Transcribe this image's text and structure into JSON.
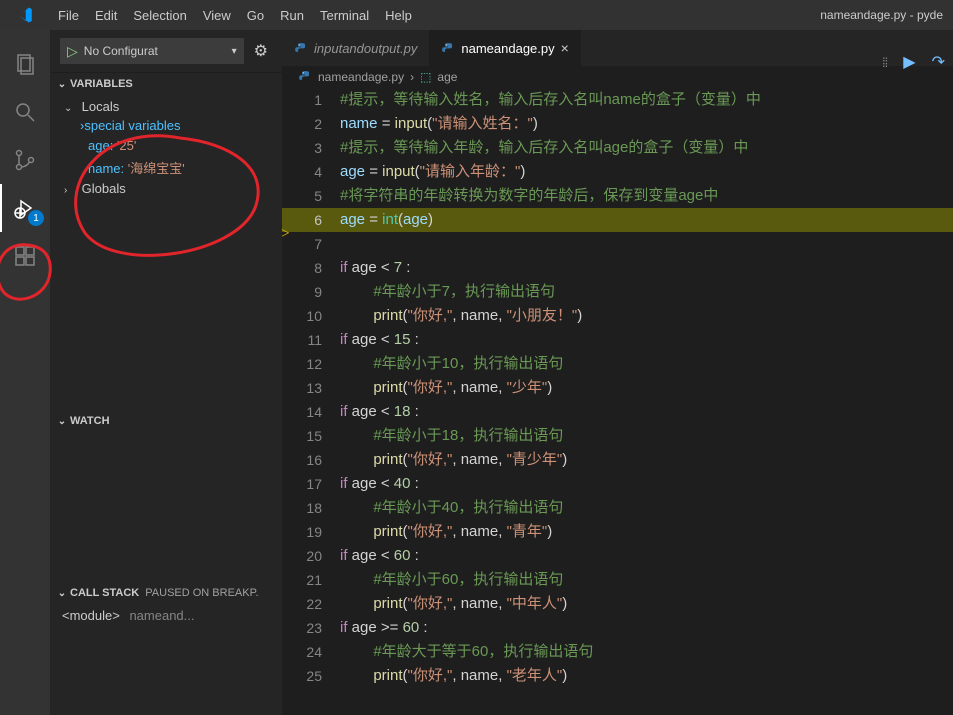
{
  "title": "nameandage.py - pyde",
  "menu": [
    "File",
    "Edit",
    "Selection",
    "View",
    "Go",
    "Run",
    "Terminal",
    "Help"
  ],
  "activitybar": {
    "debug_badge": "1"
  },
  "toolbar_icons": {
    "grip": "⁞⁞",
    "continue": "▶",
    "stepover": "↷"
  },
  "run_config": {
    "play": "▷",
    "label": "No Configurat",
    "gear": "⚙"
  },
  "panels": {
    "variables": "VARIABLES",
    "watch": "WATCH",
    "callstack": "CALL STACK",
    "callstack_status": "PAUSED ON BREAKP."
  },
  "scopes": {
    "locals": "Locals",
    "globals": "Globals",
    "special": "special variables"
  },
  "vars": [
    {
      "name": "age",
      "value": "'25'"
    },
    {
      "name": "name",
      "value": "'海绵宝宝'"
    }
  ],
  "callstack": [
    {
      "name": "<module>",
      "loc": "nameand..."
    }
  ],
  "tabs": [
    {
      "label": "inputandoutput.py",
      "active": false
    },
    {
      "label": "nameandage.py",
      "active": true
    }
  ],
  "breadcrumb": {
    "file": "nameandage.py",
    "symbol": "age"
  },
  "code": [
    {
      "n": 1,
      "tokens": [
        [
          "#提示，等待输入姓名，输入后存入名叫name的盒子（变量）中",
          "c-comm"
        ]
      ]
    },
    {
      "n": 2,
      "tokens": [
        [
          "name",
          "c-ident"
        ],
        [
          " = ",
          "c-op"
        ],
        [
          "input",
          "c-func"
        ],
        [
          "(",
          "c-op"
        ],
        [
          "\"请输入姓名：\"",
          "c-str"
        ],
        [
          ")",
          "c-op"
        ]
      ]
    },
    {
      "n": 3,
      "tokens": [
        [
          "#提示，等待输入年龄，输入后存入名叫age的盒子（变量）中",
          "c-comm"
        ]
      ]
    },
    {
      "n": 4,
      "tokens": [
        [
          "age",
          "c-ident"
        ],
        [
          " = ",
          "c-op"
        ],
        [
          "input",
          "c-func"
        ],
        [
          "(",
          "c-op"
        ],
        [
          "\"请输入年龄：\"",
          "c-str"
        ],
        [
          ")",
          "c-op"
        ]
      ]
    },
    {
      "n": 5,
      "tokens": [
        [
          "#将字符串的年龄转换为数字的年龄后，保存到变量age中",
          "c-comm"
        ]
      ]
    },
    {
      "n": 6,
      "hl": true,
      "arrow": true,
      "tokens": [
        [
          "age",
          "c-ident"
        ],
        [
          " = ",
          "c-op"
        ],
        [
          "int",
          "c-builtin"
        ],
        [
          "(",
          "c-op"
        ],
        [
          "age",
          "c-ident"
        ],
        [
          ")",
          "c-op"
        ]
      ]
    },
    {
      "n": 7,
      "tokens": []
    },
    {
      "n": 8,
      "tokens": [
        [
          "if",
          "c-kw"
        ],
        [
          " age < ",
          "c-op"
        ],
        [
          "7",
          "c-num"
        ],
        [
          " :",
          "c-op"
        ]
      ]
    },
    {
      "n": 9,
      "indent": 2,
      "tokens": [
        [
          "#年龄小于7，执行输出语句",
          "c-comm"
        ]
      ]
    },
    {
      "n": 10,
      "indent": 2,
      "tokens": [
        [
          "print",
          "c-call"
        ],
        [
          "(",
          "c-op"
        ],
        [
          "\"你好,\"",
          "c-str"
        ],
        [
          ", name, ",
          "c-op"
        ],
        [
          "\"小朋友！\"",
          "c-str"
        ],
        [
          ")",
          "c-op"
        ]
      ]
    },
    {
      "n": 11,
      "tokens": [
        [
          "if",
          "c-kw"
        ],
        [
          " age < ",
          "c-op"
        ],
        [
          "15",
          "c-num"
        ],
        [
          " :",
          "c-op"
        ]
      ]
    },
    {
      "n": 12,
      "indent": 2,
      "tokens": [
        [
          "#年龄小于10，执行输出语句",
          "c-comm"
        ]
      ]
    },
    {
      "n": 13,
      "indent": 2,
      "tokens": [
        [
          "print",
          "c-call"
        ],
        [
          "(",
          "c-op"
        ],
        [
          "\"你好,\"",
          "c-str"
        ],
        [
          ", name, ",
          "c-op"
        ],
        [
          "\"少年\"",
          "c-str"
        ],
        [
          ")",
          "c-op"
        ]
      ]
    },
    {
      "n": 14,
      "tokens": [
        [
          "if",
          "c-kw"
        ],
        [
          " age < ",
          "c-op"
        ],
        [
          "18",
          "c-num"
        ],
        [
          " :",
          "c-op"
        ]
      ]
    },
    {
      "n": 15,
      "indent": 2,
      "tokens": [
        [
          "#年龄小于18，执行输出语句",
          "c-comm"
        ]
      ]
    },
    {
      "n": 16,
      "indent": 2,
      "tokens": [
        [
          "print",
          "c-call"
        ],
        [
          "(",
          "c-op"
        ],
        [
          "\"你好,\"",
          "c-str"
        ],
        [
          ", name, ",
          "c-op"
        ],
        [
          "\"青少年\"",
          "c-str"
        ],
        [
          ")",
          "c-op"
        ]
      ]
    },
    {
      "n": 17,
      "tokens": [
        [
          "if",
          "c-kw"
        ],
        [
          " age < ",
          "c-op"
        ],
        [
          "40",
          "c-num"
        ],
        [
          " :",
          "c-op"
        ]
      ]
    },
    {
      "n": 18,
      "indent": 2,
      "tokens": [
        [
          "#年龄小于40，执行输出语句",
          "c-comm"
        ]
      ]
    },
    {
      "n": 19,
      "indent": 2,
      "tokens": [
        [
          "print",
          "c-call"
        ],
        [
          "(",
          "c-op"
        ],
        [
          "\"你好,\"",
          "c-str"
        ],
        [
          ", name, ",
          "c-op"
        ],
        [
          "\"青年\"",
          "c-str"
        ],
        [
          ")",
          "c-op"
        ]
      ]
    },
    {
      "n": 20,
      "tokens": [
        [
          "if",
          "c-kw"
        ],
        [
          " age < ",
          "c-op"
        ],
        [
          "60",
          "c-num"
        ],
        [
          " :",
          "c-op"
        ]
      ]
    },
    {
      "n": 21,
      "indent": 2,
      "tokens": [
        [
          "#年龄小于60，执行输出语句",
          "c-comm"
        ]
      ]
    },
    {
      "n": 22,
      "indent": 2,
      "tokens": [
        [
          "print",
          "c-call"
        ],
        [
          "(",
          "c-op"
        ],
        [
          "\"你好,\"",
          "c-str"
        ],
        [
          ", name, ",
          "c-op"
        ],
        [
          "\"中年人\"",
          "c-str"
        ],
        [
          ")",
          "c-op"
        ]
      ]
    },
    {
      "n": 23,
      "tokens": [
        [
          "if",
          "c-kw"
        ],
        [
          " age >= ",
          "c-op"
        ],
        [
          "60",
          "c-num"
        ],
        [
          " :",
          "c-op"
        ]
      ]
    },
    {
      "n": 24,
      "indent": 2,
      "tokens": [
        [
          "#年龄大于等于60，执行输出语句",
          "c-comm"
        ]
      ]
    },
    {
      "n": 25,
      "indent": 2,
      "tokens": [
        [
          "print",
          "c-call"
        ],
        [
          "(",
          "c-op"
        ],
        [
          "\"你好,\"",
          "c-str"
        ],
        [
          ", name, ",
          "c-op"
        ],
        [
          "\"老年人\"",
          "c-str"
        ],
        [
          ")",
          "c-op"
        ]
      ]
    }
  ]
}
